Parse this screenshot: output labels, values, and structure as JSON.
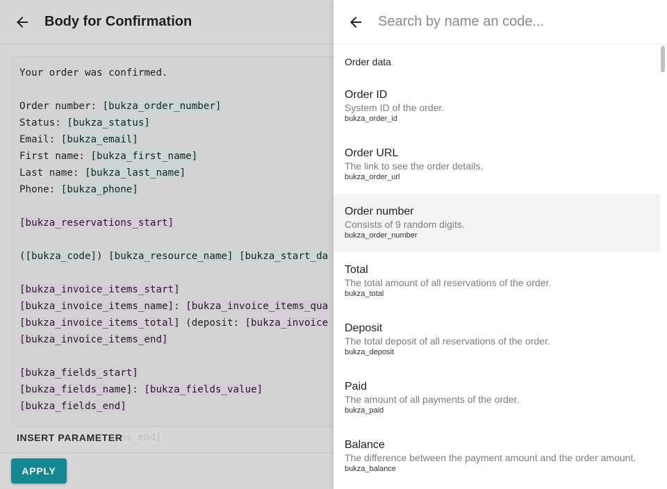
{
  "editor": {
    "title": "Body for Confirmation",
    "lines": [
      [
        {
          "t": "Your order was confirmed."
        }
      ],
      [],
      [
        {
          "t": "Order number: "
        },
        {
          "t": "[bukza_order_number]",
          "c": "b"
        }
      ],
      [
        {
          "t": "Status: "
        },
        {
          "t": "[bukza_status]",
          "c": "b"
        }
      ],
      [
        {
          "t": "Email: "
        },
        {
          "t": "[bukza_email]",
          "c": "b"
        }
      ],
      [
        {
          "t": "First name: "
        },
        {
          "t": "[bukza_first_name]",
          "c": "b"
        }
      ],
      [
        {
          "t": "Last name: "
        },
        {
          "t": "[bukza_last_name]",
          "c": "b"
        }
      ],
      [
        {
          "t": "Phone: "
        },
        {
          "t": "[bukza_phone]",
          "c": "b"
        }
      ],
      [],
      [
        {
          "t": "[bukza_reservations_start]",
          "c": "p"
        }
      ],
      [],
      [
        {
          "t": "("
        },
        {
          "t": "[bukza_code]",
          "c": "b"
        },
        {
          "t": ") "
        },
        {
          "t": "[bukza_resource_name]",
          "c": "b"
        },
        {
          "t": " "
        },
        {
          "t": "[bukza_start_da",
          "c": "b"
        }
      ],
      [],
      [
        {
          "t": "[bukza_invoice_items_start]",
          "c": "p"
        }
      ],
      [
        {
          "t": "[bukza_invoice_items_name]",
          "c": "p"
        },
        {
          "t": ": "
        },
        {
          "t": "[bukza_invoice_items_qua",
          "c": "p"
        }
      ],
      [
        {
          "t": "[bukza_invoice_items_total]",
          "c": "p"
        },
        {
          "t": " (deposit: "
        },
        {
          "t": "[bukza_invoice",
          "c": "p"
        }
      ],
      [
        {
          "t": "[bukza_invoice_items_end]",
          "c": "p"
        }
      ],
      [],
      [
        {
          "t": "[bukza_fields_start]",
          "c": "p"
        }
      ],
      [
        {
          "t": "[bukza_fields_name]",
          "c": "p"
        },
        {
          "t": ": "
        },
        {
          "t": "[bukza_fields_value]",
          "c": "p"
        }
      ],
      [
        {
          "t": "[bukza_fields_end]",
          "c": "p"
        }
      ]
    ],
    "faded_line": "ns_end]",
    "insert_label": "INSERT PARAMETER",
    "apply_label": "APPLY"
  },
  "search": {
    "placeholder": "Search by name an code..."
  },
  "parameters": {
    "section": "Order data",
    "items": [
      {
        "name": "Order ID",
        "desc": "System ID of the order.",
        "code": "bukza_order_id"
      },
      {
        "name": "Order URL",
        "desc": "The link to see the order details.",
        "code": "bukza_order_url"
      },
      {
        "name": "Order number",
        "desc": "Consists of 9 random digits.",
        "code": "bukza_order_number",
        "hovered": true
      },
      {
        "name": "Total",
        "desc": "The total amount of all reservations of the order.",
        "code": "bukza_total"
      },
      {
        "name": "Deposit",
        "desc": "The total deposit of all reservations of the order.",
        "code": "bukza_deposit"
      },
      {
        "name": "Paid",
        "desc": "The amount of all payments of the order.",
        "code": "bukza_paid"
      },
      {
        "name": "Balance",
        "desc": "The difference between the payment amount and the order amount.",
        "code": "bukza_balance"
      }
    ]
  },
  "colors": {
    "accent": "#148891",
    "token_basic": "#c9d6d6",
    "token_block": "#d7cad9"
  }
}
